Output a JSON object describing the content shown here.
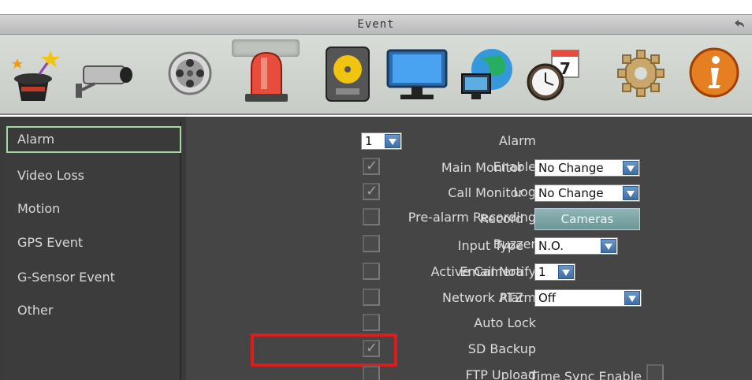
{
  "window": {
    "title": "Event",
    "back_icon": "undo-icon"
  },
  "toolbar_icons": [
    {
      "name": "wizard-hat-icon"
    },
    {
      "name": "camera-icon"
    },
    {
      "name": "film-reel-icon"
    },
    {
      "name": "alarm-siren-icon",
      "selected": true
    },
    {
      "name": "hard-drive-icon"
    },
    {
      "name": "monitor-icon"
    },
    {
      "name": "network-globe-icon"
    },
    {
      "name": "clock-calendar-icon"
    },
    {
      "name": "gear-icon"
    },
    {
      "name": "info-icon"
    }
  ],
  "sidebar": {
    "items": [
      {
        "label": "Alarm",
        "active": true
      },
      {
        "label": "Video Loss"
      },
      {
        "label": "Motion"
      },
      {
        "label": "GPS Event"
      },
      {
        "label": "G-Sensor Event"
      },
      {
        "label": "Other"
      }
    ]
  },
  "form": {
    "alarm": {
      "label": "Alarm",
      "value": "1"
    },
    "enable": {
      "label": "Enable",
      "checked": true
    },
    "log": {
      "label": "Log",
      "checked": true
    },
    "pre_alarm": {
      "label": "Pre-alarm Recording",
      "checked": false
    },
    "buzzer": {
      "label": "Buzzer",
      "checked": false
    },
    "email": {
      "label": "Email Notify",
      "checked": false
    },
    "network_alarm": {
      "label": "Network Alarm",
      "checked": false
    },
    "auto_lock": {
      "label": "Auto Lock",
      "checked": false
    },
    "sd_backup": {
      "label": "SD Backup",
      "checked": true
    },
    "ftp_upload": {
      "label": "FTP Upload",
      "checked": false
    },
    "main_monitor": {
      "label": "Main Monitor",
      "value": "No Change"
    },
    "call_monitor": {
      "label": "Call Monitor",
      "value": "No Change"
    },
    "record": {
      "label": "Record",
      "button": "Cameras"
    },
    "input_type": {
      "label": "Input Type",
      "value": "N.O."
    },
    "active_camera": {
      "label": "Active Camera",
      "value": "1"
    },
    "ptz": {
      "label": "PTZ",
      "value": "Off"
    },
    "time_sync": {
      "label": "Time Sync Enable",
      "checked": false
    }
  },
  "colors": {
    "highlight": "#e11b1b",
    "active_border": "#a6d8a2",
    "dropdown_button": "#3d6ea8"
  }
}
